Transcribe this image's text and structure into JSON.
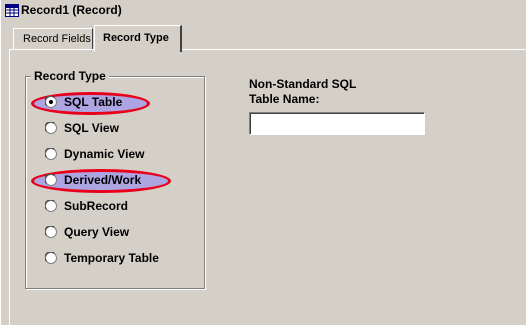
{
  "window": {
    "title": "Record1 (Record)",
    "icon": "record-definition-icon"
  },
  "tabs": [
    {
      "label": "Record Fields",
      "selected": false
    },
    {
      "label": "Record Type",
      "selected": true
    }
  ],
  "record_type_group": {
    "legend": "Record Type",
    "options": [
      {
        "label": "SQL Table",
        "selected": true,
        "highlighted": true
      },
      {
        "label": "SQL View",
        "selected": false,
        "highlighted": false
      },
      {
        "label": "Dynamic View",
        "selected": false,
        "highlighted": false
      },
      {
        "label": "Derived/Work",
        "selected": false,
        "highlighted": true
      },
      {
        "label": "SubRecord",
        "selected": false,
        "highlighted": false
      },
      {
        "label": "Query View",
        "selected": false,
        "highlighted": false
      },
      {
        "label": "Temporary Table",
        "selected": false,
        "highlighted": false
      }
    ]
  },
  "sql_table_name": {
    "label_line1": "Non-Standard SQL",
    "label_line2": "Table Name:",
    "value": "",
    "placeholder": ""
  },
  "colors": {
    "window_bg": "#d4d0c8",
    "highlight_fill": "#a096eb",
    "highlight_outline": "#e8001a"
  }
}
